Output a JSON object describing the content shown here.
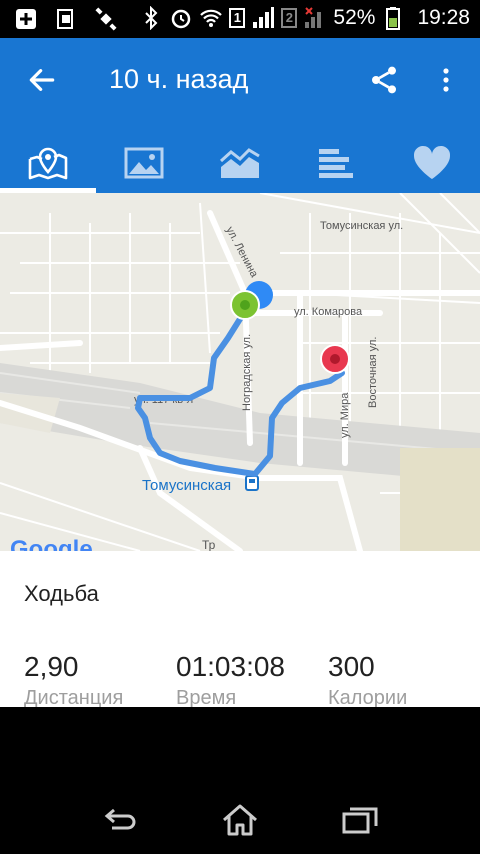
{
  "status_bar": {
    "battery_percent": "52%",
    "time": "19:28",
    "sim1": "1",
    "sim2": "2"
  },
  "appbar": {
    "title": "10 ч. назад"
  },
  "tabs": [
    {
      "icon": "map-icon",
      "active": true
    },
    {
      "icon": "image-icon",
      "active": false
    },
    {
      "icon": "chart-icon",
      "active": false
    },
    {
      "icon": "splits-icon",
      "active": false
    },
    {
      "icon": "heart-icon",
      "active": false
    }
  ],
  "map": {
    "streets": {
      "tomusinskaya_ul": "Томусинская ул.",
      "lenina": "ул. Ленина",
      "komarova": "ул. Комарова",
      "nogradskaya": "Ноградская ул.",
      "vostochnaya": "Восточная ул.",
      "mira": "ул. Мира",
      "kvl_117": "ул. 117 кв-л",
      "tomusinskaya": "Томусинская",
      "tr": "Тр"
    },
    "google_logo": "Google",
    "colors": {
      "route": "#4a90e2",
      "start": "#7cc332",
      "end": "#e8384f",
      "current": "#2f8af5"
    }
  },
  "activity": {
    "type": "Ходьба",
    "stats": [
      {
        "value": "2,90",
        "label": "Дистанция"
      },
      {
        "value": "01:03:08",
        "label": "Время"
      },
      {
        "value": "300",
        "label": "Калории"
      }
    ]
  }
}
